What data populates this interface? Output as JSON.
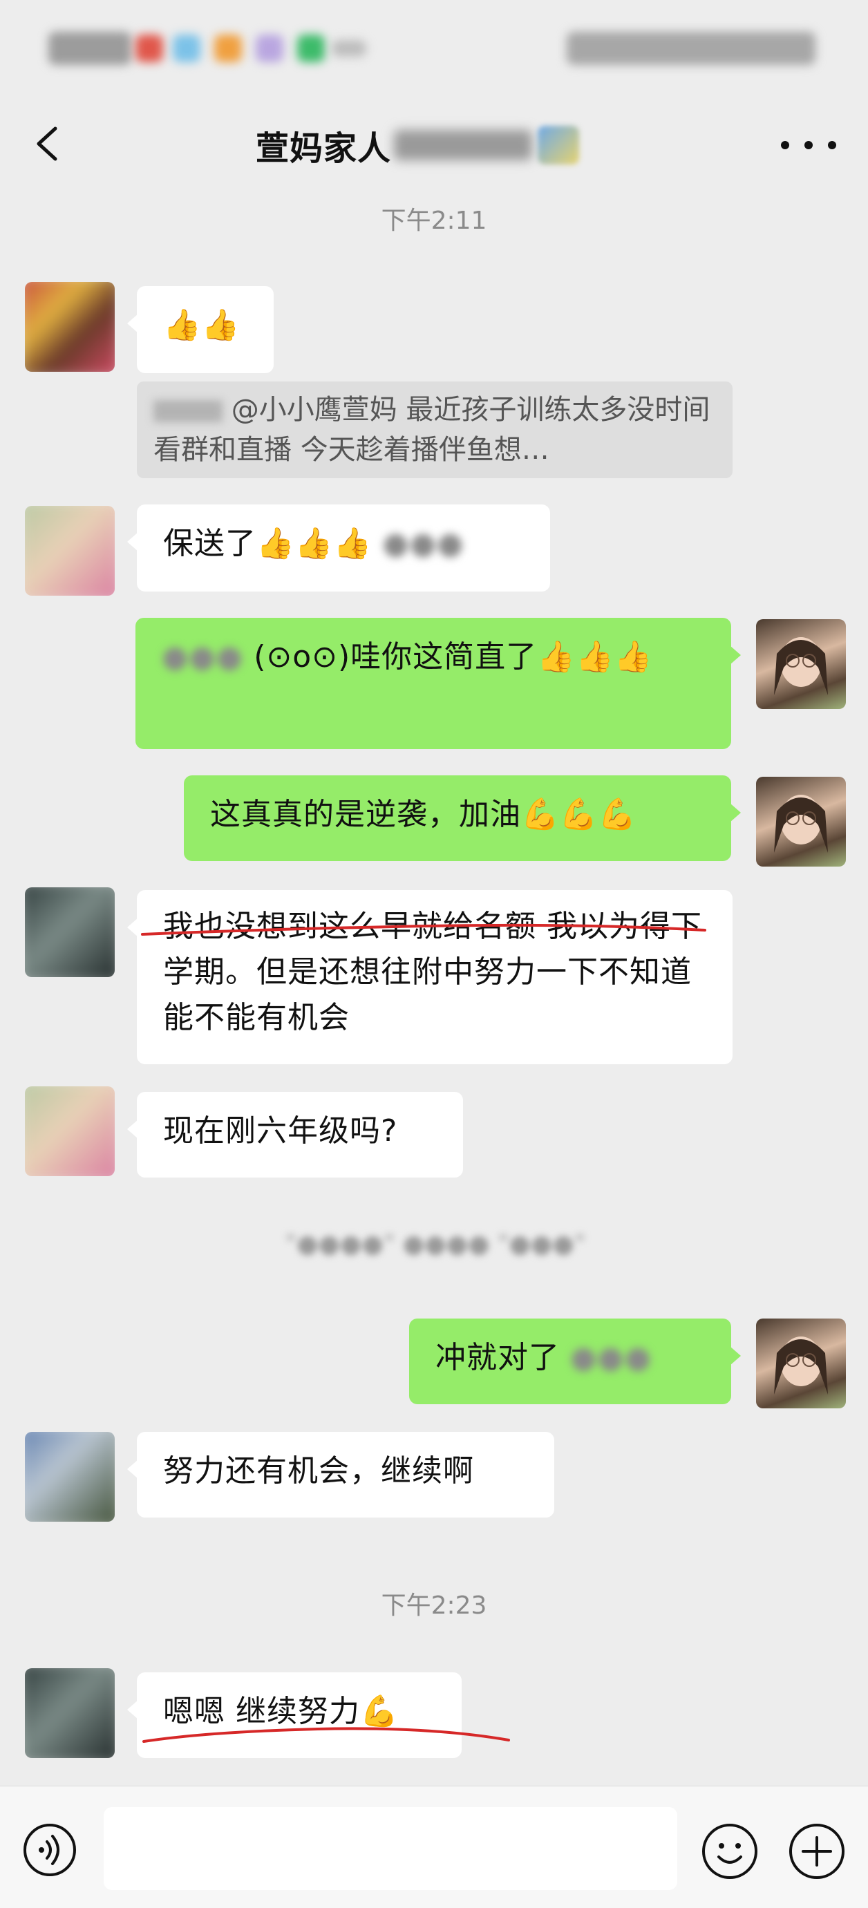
{
  "status_bar": {
    "left_blurred": "2:23",
    "right_blurred": "4G 58"
  },
  "header": {
    "title": "萱妈家人"
  },
  "messages": {
    "time1": "下午2:11",
    "m1": {
      "text": "👍👍"
    },
    "quote": {
      "text": "@小小鹰萱妈  最近孩子训练太多没时间看群和直播  今天趁着播伴鱼想…"
    },
    "m2": {
      "text": "保送了👍👍👍"
    },
    "m3": {
      "text": "(⊙o⊙)哇你这简直了👍👍👍"
    },
    "m4": {
      "text": "这真真的是逆袭，加油💪💪💪"
    },
    "m5": {
      "text": "我也没想到这么早就给名额 我以为得下学期。但是还想往附中努力一下不知道能不能有机会"
    },
    "m6": {
      "text": "现在刚六年级吗?"
    },
    "m7": {
      "text": "冲就对了"
    },
    "m8": {
      "text": "努力还有机会，继续啊"
    },
    "time2": "下午2:23",
    "m9": {
      "text": "嗯嗯 继续努力💪"
    }
  },
  "input_bar": {
    "placeholder": ""
  },
  "colors": {
    "background": "#EDEDED",
    "self_bubble": "#95EC69",
    "other_bubble": "#FFFFFF",
    "annotation_red": "#D62828"
  }
}
